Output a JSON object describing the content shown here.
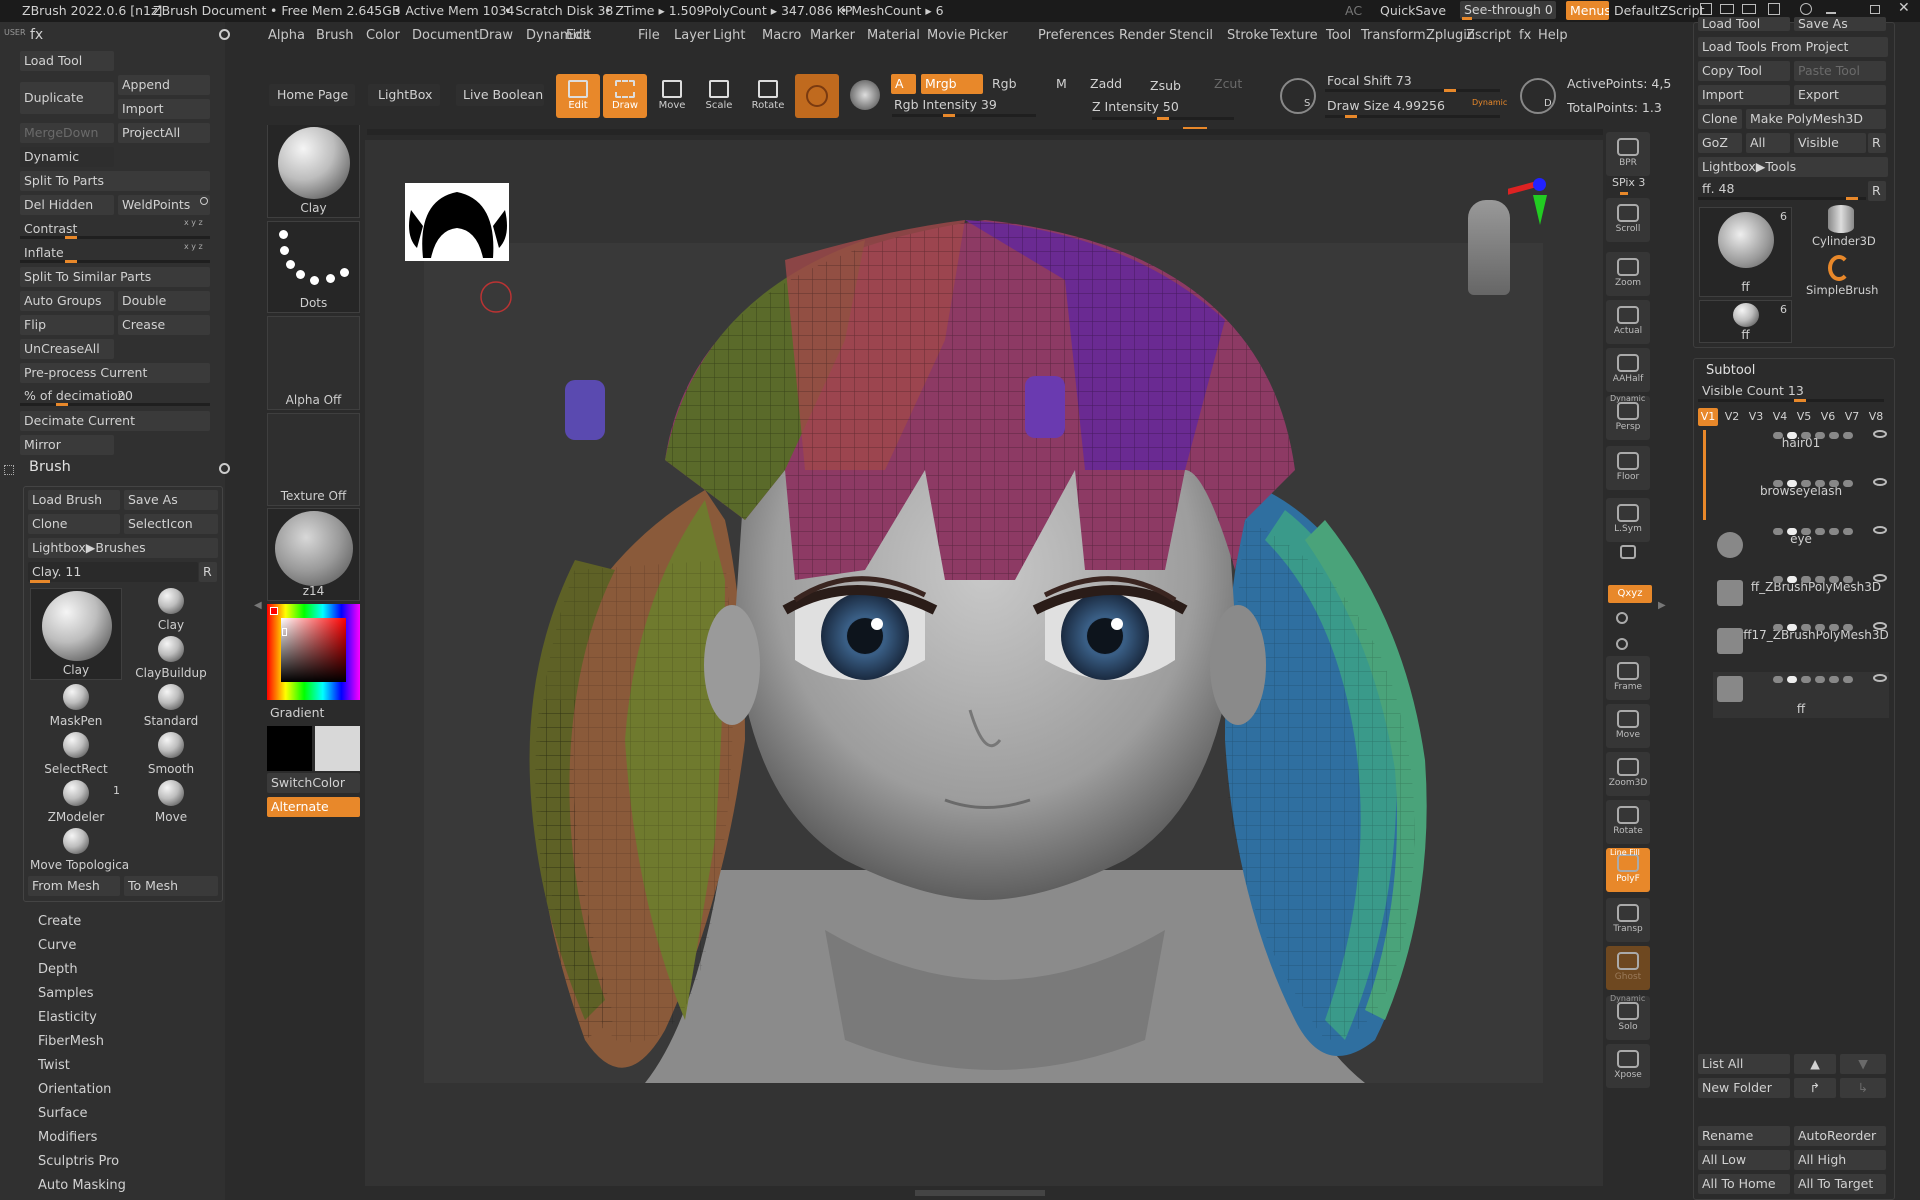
{
  "titlebar": {
    "app": "ZBrush 2022.0.6 [n1z]",
    "doc": "ZBrush Document",
    "free_mem": "• Free Mem 2.645GB",
    "active_mem": "• Active Mem 1034",
    "scratch": "• Scratch Disk 38",
    "ztime": "• ZTime ▸ 1.509",
    "polycount": "PolyCount ▸ 347.086 KP",
    "meshcount": "• MeshCount ▸ 6",
    "ac": "AC",
    "quicksave": "QuickSave",
    "seethrough": "See-through  0",
    "menus": "Menus",
    "script": "DefaultZScript"
  },
  "menubar": [
    "Alpha",
    "Brush",
    "Color",
    "Document",
    "Draw",
    "Dynamics",
    "Edit",
    "File",
    "Layer",
    "Light",
    "Macro",
    "Marker",
    "Material",
    "Movie",
    "Picker",
    "Preferences",
    "Render",
    "Stencil",
    "Stroke",
    "Texture",
    "Tool",
    "Transform",
    "Zplugin",
    "Zscript",
    "fx",
    "Help"
  ],
  "left": {
    "user": "USER",
    "fx": "fx",
    "load_tool": "Load Tool",
    "duplicate": "Duplicate",
    "append": "Append",
    "import": "Import",
    "mergedown": "MergeDown",
    "projectall": "ProjectAll",
    "dynamic": "Dynamic",
    "split_to_parts": "Split To Parts",
    "del_hidden": "Del Hidden",
    "weldpoints": "WeldPoints",
    "contrast": "Contrast",
    "inflate": "Inflate",
    "contrast_level": 0.25,
    "inflate_level": 0.25,
    "split_similar": "Split To Similar Parts",
    "auto_groups": "Auto Groups",
    "double": "Double",
    "flip": "Flip",
    "crease": "Crease",
    "uncreaseall": "UnCreaseAll",
    "preprocess": "Pre-process Current",
    "decimation_label": "% of decimation",
    "decimation_value": "20",
    "decimation_level": 0.2,
    "decimate_current": "Decimate Current",
    "mirror": "Mirror",
    "brush_hdr": "Brush",
    "load_brush": "Load Brush",
    "save_as": "Save As",
    "clone": "Clone",
    "selecticon": "SelectIcon",
    "lightbox_brushes": "Lightbox▶Brushes",
    "current_brush": "Clay. 11",
    "r": "R",
    "brushes": [
      {
        "name": "Clay"
      },
      {
        "name": "Clay"
      },
      {
        "name": "ClayBuildup"
      },
      {
        "name": "MaskPen"
      },
      {
        "name": "Standard"
      },
      {
        "name": "SelectRect"
      },
      {
        "name": "Smooth"
      },
      {
        "name": "ZModeler"
      },
      {
        "name": "Move"
      },
      {
        "name": "Move Topologica"
      }
    ],
    "zmodeler_count": "1",
    "from_mesh": "From Mesh",
    "to_mesh": "To Mesh",
    "menu_items": [
      "Create",
      "Curve",
      "Depth",
      "Samples",
      "Elasticity",
      "FiberMesh",
      "Twist",
      "Orientation",
      "Surface",
      "Modifiers",
      "Sculptris Pro",
      "Auto Masking"
    ]
  },
  "shelf": {
    "clay": "Clay",
    "dots": "Dots",
    "alpha_off": "Alpha Off",
    "texture_off": "Texture Off",
    "material": "z14",
    "gradient": "Gradient",
    "switchcolor": "SwitchColor",
    "alternate": "Alternate"
  },
  "toolbar": {
    "home": "Home Page",
    "lightbox": "LightBox",
    "live_boolean": "Live Boolean",
    "edit": "Edit",
    "draw": "Draw",
    "move": "Move",
    "scale": "Scale",
    "rotate": "Rotate",
    "a": "A",
    "mrgb": "Mrgb",
    "rgb": "Rgb",
    "m": "M",
    "zadd": "Zadd",
    "zsub": "Zsub",
    "zcut": "Zcut",
    "rgb_intensity": "Rgb Intensity 39",
    "rgb_intensity_level": 0.39,
    "z_intensity": "Z Intensity 50",
    "z_intensity_level": 0.5,
    "focal_shift": "Focal Shift 73",
    "focal_shift_level": 0.73,
    "draw_size": "Draw Size 4.99256",
    "draw_size_level": 0.12,
    "dynamic": "Dynamic",
    "s": "S",
    "d": "D",
    "active_points": "ActivePoints: 4,5",
    "total_points": "TotalPoints: 1.3"
  },
  "rightbar": {
    "bpr": "BPR",
    "spix": "SPix 3",
    "spix_level": 0.3,
    "scroll": "Scroll",
    "zoom": "Zoom",
    "actual": "Actual",
    "aahalf": "AAHalf",
    "dynamic": "Dynamic",
    "persp": "Persp",
    "floor": "Floor",
    "lsym": "L.Sym",
    "xyz": "Qxyz",
    "frame": "Frame",
    "move": "Move",
    "zoom3d": "Zoom3D",
    "rotate": "Rotate",
    "linefill": "Line Fill",
    "polyf": "PolyF",
    "transp": "Transp",
    "ghost": "Ghost",
    "solo": "Solo",
    "xpose": "Xpose"
  },
  "tool": {
    "load_tool": "Load Tool",
    "save_as": "Save As",
    "load_from_project": "Load Tools From Project",
    "copy_tool": "Copy Tool",
    "paste_tool": "Paste Tool",
    "import": "Import",
    "export": "Export",
    "clone": "Clone",
    "make_polymesh": "Make PolyMesh3D",
    "goz": "GoZ",
    "all": "All",
    "visible": "Visible",
    "r": "R",
    "lightbox_tools": "Lightbox▶Tools",
    "current": "ff. 48",
    "current_level": 0.95,
    "thumbs": [
      {
        "name": "ff",
        "count": "6"
      },
      {
        "name": "Cylinder3D"
      },
      {
        "name": "SimpleBrush"
      },
      {
        "name": "ff",
        "count": "6"
      }
    ]
  },
  "subtool": {
    "header": "Subtool",
    "visible_count": "Visible Count 13",
    "visible_count_level": 0.55,
    "versions": [
      "V1",
      "V2",
      "V3",
      "V4",
      "V5",
      "V6",
      "V7",
      "V8"
    ],
    "items": [
      {
        "name": "hair01"
      },
      {
        "name": "browseyelash"
      },
      {
        "name": "eye"
      },
      {
        "name": "ff_ZBrushPolyMesh3D"
      },
      {
        "name": "ff17_ZBrushPolyMesh3D"
      },
      {
        "name": "ff"
      }
    ],
    "list_all": "List All",
    "new_folder": "New Folder",
    "rename": "Rename",
    "autoreorder": "AutoReorder",
    "all_low": "All Low",
    "all_high": "All High",
    "all_to_home": "All To Home",
    "all_to_target": "All To Target"
  },
  "colors": {
    "accent": "#e8882a",
    "bg": "#2b2b2b",
    "panel": "#303030",
    "button": "#3a3a3a"
  }
}
